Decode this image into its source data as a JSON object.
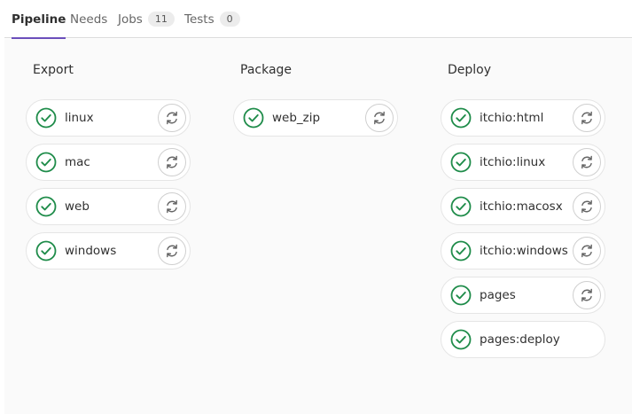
{
  "tabs": {
    "pipeline": "Pipeline",
    "needs": "Needs",
    "jobs": "Jobs",
    "jobs_count": "11",
    "tests": "Tests",
    "tests_count": "0"
  },
  "stages": {
    "export": {
      "title": "Export",
      "jobs": [
        "linux",
        "mac",
        "web",
        "windows"
      ]
    },
    "package": {
      "title": "Package",
      "jobs": [
        "web_zip"
      ]
    },
    "deploy": {
      "title": "Deploy",
      "jobs": [
        "itchio:html",
        "itchio:linux",
        "itchio:macosx",
        "itchio:windows",
        "pages",
        "pages:deploy"
      ]
    }
  },
  "colors": {
    "success": "#1f8c4a",
    "active_tab": "#6b4fbb",
    "retry_icon": "#666666"
  },
  "icons": {
    "status": "status-success-icon",
    "retry": "retry-icon"
  }
}
